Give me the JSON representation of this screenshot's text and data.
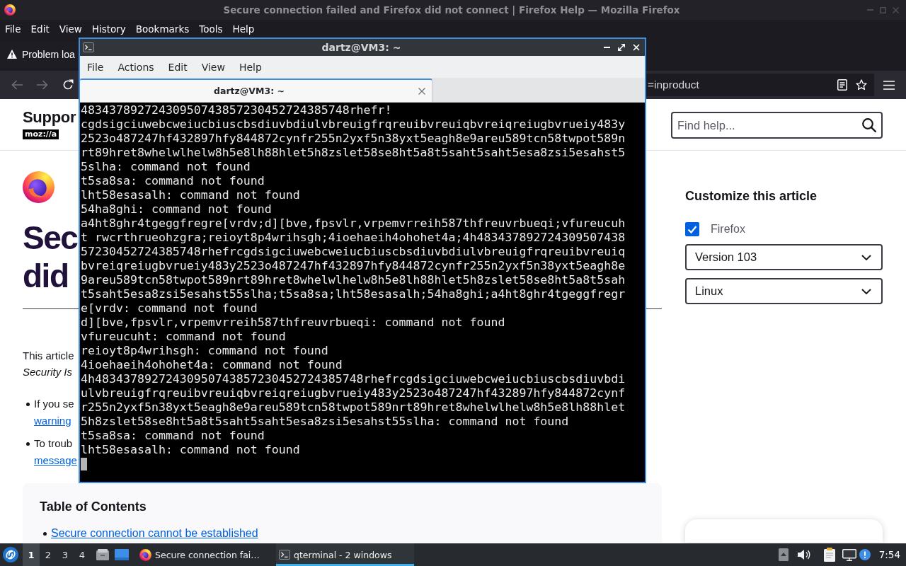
{
  "firefox": {
    "title": "Secure connection failed and Firefox did not connect | Firefox Help — Mozilla Firefox",
    "menu": [
      "File",
      "Edit",
      "View",
      "History",
      "Bookmarks",
      "Tools",
      "Help"
    ],
    "tabs": [
      {
        "label": "Problem loa",
        "selected": true
      }
    ],
    "nav_buttons": [
      {
        "kind": "back",
        "disabled": true
      },
      {
        "kind": "forward",
        "disabled": true
      },
      {
        "kind": "reload",
        "disabled": false
      }
    ],
    "url": "=inproduct"
  },
  "page": {
    "site_name": "Suppor",
    "logo": "moz://a",
    "search": {
      "placeholder": "Find help..."
    },
    "heading_lines": [
      "Sec",
      "did"
    ],
    "intro_lines": [
      {
        "text": "This article",
        "italic": false
      },
      {
        "text": "Security Is",
        "italic": true
      }
    ],
    "bullets": [
      {
        "text": "If you se",
        "link": "warning"
      },
      {
        "text": "To troub",
        "link": "message"
      }
    ],
    "toc": {
      "title": "Table of Contents",
      "items": [
        "Secure connection cannot be established"
      ]
    },
    "customize": {
      "title": "Customize this article",
      "product": {
        "label": "Firefox",
        "checked": true
      },
      "selects": [
        "Version 103",
        "Linux"
      ]
    }
  },
  "terminal": {
    "title": "dartz@VM3: ~",
    "menu": [
      "File",
      "Actions",
      "Edit",
      "View",
      "Help"
    ],
    "tabs": [
      {
        "label": "dartz@VM3: ~",
        "selected": true
      }
    ],
    "lines": [
      "48343789272430950743857230452724385748rhefr!",
      "cgdsigciuwebcweiucbiuscbsdiuvbdiulvbreuigfrqreuibvreuiqbvreiqreiugbvrueiy483y",
      "2523o487247hf432897hfy844872cynfr255n2yxf5n38yxt5eagh8e9areu589tcn58twpot589n",
      "rt89hret8whelwlhelw8h5e8lh88hlet5h8zslet58se8ht5a8t5saht5saht5esa8zsi5esahst5",
      "5slha: command not found",
      "t5sa8sa: command not found",
      "lht58esasalh: command not found",
      "54ha8ghi: command not found",
      "a4ht8ghr4tgeggfregre[vrdv;d][bve,fpsvlr,vrpemvrreih587thfreuvrbueqi;vfureucuh",
      "t rwcrthrueohzgra;reioyt8p4wrihsgh;4ioehaeih4ohohet4a;4h483437892724309507438",
      "57230452724385748rhefrcgdsigciuwebcweiucbiuscbsdiuvbdiulvbreuigfrqreuibvreuiq",
      "bvreiqreiugbvrueiy483y2523o487247hf432897hfy844872cynfr255n2yxf5n38yxt5eagh8e",
      "9areu589tcn58twpot589nrt89hret8whelwlhelw8h5e8lh88hlet5h8zslet58se8ht5a8t5sah",
      "t5saht5esa8zsi5esahst55slha;t5sa8sa;lht58esasalh;54ha8ghi;a4ht8ghr4tgeggfregr",
      "e[vrdv: command not found",
      "d][bve,fpsvlr,vrpemvrreih587thfreuvrbueqi: command not found",
      "vfureucuht: command not found",
      "reioyt8p4wrihsgh: command not found",
      "4ioehaeih4ohohet4a: command not found",
      "4h48343789272430950743857230452724385748rhefrcgdsigciuwebcweiucbiuscbsdiuvbdi",
      "ulvbreuigfrqreuibvreuiqbvreiqreiugbvrueiy483y2523o487247hf432897hfy844872cynf",
      "r255n2yxf5n38yxt5eagh8e9areu589tcn58twpot589nrt89hret8whelwlhelw8h5e8lh88hlet",
      "5h8zslet58se8ht5a8t5saht5saht5esa8zsi5esahst55slha: command not found",
      "t5sa8sa: command not found",
      "lht58esasalh: command not found"
    ]
  },
  "taskbar": {
    "workspaces": [
      {
        "label": "1",
        "selected": true
      },
      {
        "label": "2",
        "selected": false
      },
      {
        "label": "3",
        "selected": false
      },
      {
        "label": "4",
        "selected": false
      }
    ],
    "tasks": [
      {
        "kind": "browser",
        "label": "Secure connection fai…",
        "selected": false
      },
      {
        "kind": "terminal",
        "label": "qterminal - 2 windows",
        "selected": true
      }
    ],
    "clock": "7:54"
  }
}
